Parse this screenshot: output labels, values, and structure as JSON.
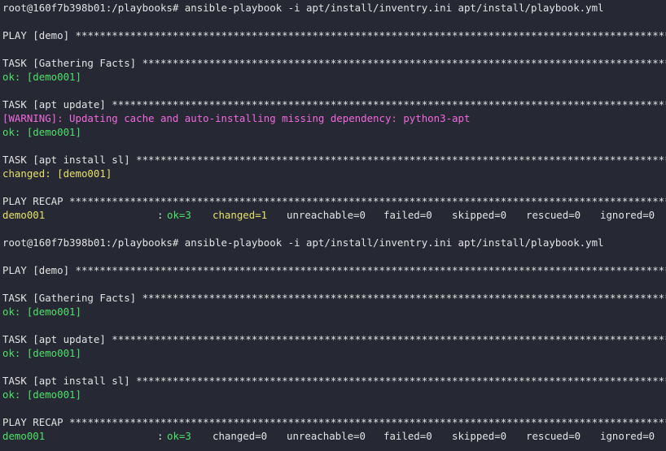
{
  "colors": {
    "background": "#262833",
    "text": "#e3e3e3",
    "ok": "#4ee06a",
    "changed": "#e6e06a",
    "warning": "#f06adf"
  },
  "stars": "****************************************************************************************************",
  "runs": [
    {
      "prompt": "root@160f7b398b01:/playbooks# ansible-playbook -i apt/install/inventry.ini apt/install/playbook.yml",
      "play_header": "PLAY [demo] ",
      "tasks": [
        {
          "header": "TASK [Gathering Facts] ",
          "warning": "",
          "result": "ok: [demo001]",
          "result_type": "ok"
        },
        {
          "header": "TASK [apt update] ",
          "warning": "[WARNING]: Updating cache and auto-installing missing dependency: python3-apt",
          "result": "ok: [demo001]",
          "result_type": "ok"
        },
        {
          "header": "TASK [apt install sl] ",
          "warning": "",
          "result": "changed: [demo001]",
          "result_type": "changed"
        }
      ],
      "recap_header": "PLAY RECAP ",
      "recap": {
        "host": "demo001",
        "sep": ":",
        "ok": "ok=3",
        "changed": "changed=1",
        "unreachable": "unreachable=0",
        "failed": "failed=0",
        "skipped": "skipped=0",
        "rescued": "rescued=0",
        "ignored": "ignored=0"
      }
    },
    {
      "prompt": "root@160f7b398b01:/playbooks# ansible-playbook -i apt/install/inventry.ini apt/install/playbook.yml",
      "play_header": "PLAY [demo] ",
      "tasks": [
        {
          "header": "TASK [Gathering Facts] ",
          "warning": "",
          "result": "ok: [demo001]",
          "result_type": "ok"
        },
        {
          "header": "TASK [apt update] ",
          "warning": "",
          "result": "ok: [demo001]",
          "result_type": "ok"
        },
        {
          "header": "TASK [apt install sl] ",
          "warning": "",
          "result": "ok: [demo001]",
          "result_type": "ok"
        }
      ],
      "recap_header": "PLAY RECAP ",
      "recap": {
        "host": "demo001",
        "sep": ":",
        "ok": "ok=3",
        "changed": "changed=0",
        "unreachable": "unreachable=0",
        "failed": "failed=0",
        "skipped": "skipped=0",
        "rescued": "rescued=0",
        "ignored": "ignored=0"
      }
    }
  ]
}
